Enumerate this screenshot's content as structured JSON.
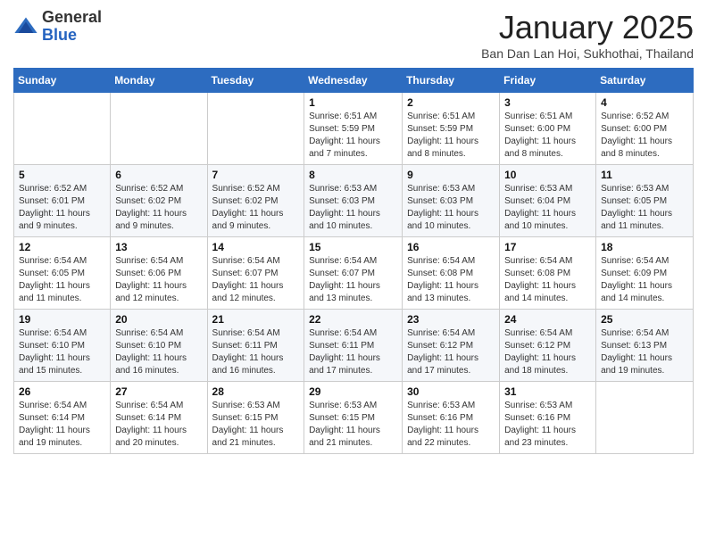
{
  "header": {
    "logo_general": "General",
    "logo_blue": "Blue",
    "month_title": "January 2025",
    "subtitle": "Ban Dan Lan Hoi, Sukhothai, Thailand"
  },
  "days_of_week": [
    "Sunday",
    "Monday",
    "Tuesday",
    "Wednesday",
    "Thursday",
    "Friday",
    "Saturday"
  ],
  "weeks": [
    [
      {
        "day": "",
        "sunrise": "",
        "sunset": "",
        "daylight": ""
      },
      {
        "day": "",
        "sunrise": "",
        "sunset": "",
        "daylight": ""
      },
      {
        "day": "",
        "sunrise": "",
        "sunset": "",
        "daylight": ""
      },
      {
        "day": "1",
        "sunrise": "Sunrise: 6:51 AM",
        "sunset": "Sunset: 5:59 PM",
        "daylight": "Daylight: 11 hours and 7 minutes."
      },
      {
        "day": "2",
        "sunrise": "Sunrise: 6:51 AM",
        "sunset": "Sunset: 5:59 PM",
        "daylight": "Daylight: 11 hours and 8 minutes."
      },
      {
        "day": "3",
        "sunrise": "Sunrise: 6:51 AM",
        "sunset": "Sunset: 6:00 PM",
        "daylight": "Daylight: 11 hours and 8 minutes."
      },
      {
        "day": "4",
        "sunrise": "Sunrise: 6:52 AM",
        "sunset": "Sunset: 6:00 PM",
        "daylight": "Daylight: 11 hours and 8 minutes."
      }
    ],
    [
      {
        "day": "5",
        "sunrise": "Sunrise: 6:52 AM",
        "sunset": "Sunset: 6:01 PM",
        "daylight": "Daylight: 11 hours and 9 minutes."
      },
      {
        "day": "6",
        "sunrise": "Sunrise: 6:52 AM",
        "sunset": "Sunset: 6:02 PM",
        "daylight": "Daylight: 11 hours and 9 minutes."
      },
      {
        "day": "7",
        "sunrise": "Sunrise: 6:52 AM",
        "sunset": "Sunset: 6:02 PM",
        "daylight": "Daylight: 11 hours and 9 minutes."
      },
      {
        "day": "8",
        "sunrise": "Sunrise: 6:53 AM",
        "sunset": "Sunset: 6:03 PM",
        "daylight": "Daylight: 11 hours and 10 minutes."
      },
      {
        "day": "9",
        "sunrise": "Sunrise: 6:53 AM",
        "sunset": "Sunset: 6:03 PM",
        "daylight": "Daylight: 11 hours and 10 minutes."
      },
      {
        "day": "10",
        "sunrise": "Sunrise: 6:53 AM",
        "sunset": "Sunset: 6:04 PM",
        "daylight": "Daylight: 11 hours and 10 minutes."
      },
      {
        "day": "11",
        "sunrise": "Sunrise: 6:53 AM",
        "sunset": "Sunset: 6:05 PM",
        "daylight": "Daylight: 11 hours and 11 minutes."
      }
    ],
    [
      {
        "day": "12",
        "sunrise": "Sunrise: 6:54 AM",
        "sunset": "Sunset: 6:05 PM",
        "daylight": "Daylight: 11 hours and 11 minutes."
      },
      {
        "day": "13",
        "sunrise": "Sunrise: 6:54 AM",
        "sunset": "Sunset: 6:06 PM",
        "daylight": "Daylight: 11 hours and 12 minutes."
      },
      {
        "day": "14",
        "sunrise": "Sunrise: 6:54 AM",
        "sunset": "Sunset: 6:07 PM",
        "daylight": "Daylight: 11 hours and 12 minutes."
      },
      {
        "day": "15",
        "sunrise": "Sunrise: 6:54 AM",
        "sunset": "Sunset: 6:07 PM",
        "daylight": "Daylight: 11 hours and 13 minutes."
      },
      {
        "day": "16",
        "sunrise": "Sunrise: 6:54 AM",
        "sunset": "Sunset: 6:08 PM",
        "daylight": "Daylight: 11 hours and 13 minutes."
      },
      {
        "day": "17",
        "sunrise": "Sunrise: 6:54 AM",
        "sunset": "Sunset: 6:08 PM",
        "daylight": "Daylight: 11 hours and 14 minutes."
      },
      {
        "day": "18",
        "sunrise": "Sunrise: 6:54 AM",
        "sunset": "Sunset: 6:09 PM",
        "daylight": "Daylight: 11 hours and 14 minutes."
      }
    ],
    [
      {
        "day": "19",
        "sunrise": "Sunrise: 6:54 AM",
        "sunset": "Sunset: 6:10 PM",
        "daylight": "Daylight: 11 hours and 15 minutes."
      },
      {
        "day": "20",
        "sunrise": "Sunrise: 6:54 AM",
        "sunset": "Sunset: 6:10 PM",
        "daylight": "Daylight: 11 hours and 16 minutes."
      },
      {
        "day": "21",
        "sunrise": "Sunrise: 6:54 AM",
        "sunset": "Sunset: 6:11 PM",
        "daylight": "Daylight: 11 hours and 16 minutes."
      },
      {
        "day": "22",
        "sunrise": "Sunrise: 6:54 AM",
        "sunset": "Sunset: 6:11 PM",
        "daylight": "Daylight: 11 hours and 17 minutes."
      },
      {
        "day": "23",
        "sunrise": "Sunrise: 6:54 AM",
        "sunset": "Sunset: 6:12 PM",
        "daylight": "Daylight: 11 hours and 17 minutes."
      },
      {
        "day": "24",
        "sunrise": "Sunrise: 6:54 AM",
        "sunset": "Sunset: 6:12 PM",
        "daylight": "Daylight: 11 hours and 18 minutes."
      },
      {
        "day": "25",
        "sunrise": "Sunrise: 6:54 AM",
        "sunset": "Sunset: 6:13 PM",
        "daylight": "Daylight: 11 hours and 19 minutes."
      }
    ],
    [
      {
        "day": "26",
        "sunrise": "Sunrise: 6:54 AM",
        "sunset": "Sunset: 6:14 PM",
        "daylight": "Daylight: 11 hours and 19 minutes."
      },
      {
        "day": "27",
        "sunrise": "Sunrise: 6:54 AM",
        "sunset": "Sunset: 6:14 PM",
        "daylight": "Daylight: 11 hours and 20 minutes."
      },
      {
        "day": "28",
        "sunrise": "Sunrise: 6:53 AM",
        "sunset": "Sunset: 6:15 PM",
        "daylight": "Daylight: 11 hours and 21 minutes."
      },
      {
        "day": "29",
        "sunrise": "Sunrise: 6:53 AM",
        "sunset": "Sunset: 6:15 PM",
        "daylight": "Daylight: 11 hours and 21 minutes."
      },
      {
        "day": "30",
        "sunrise": "Sunrise: 6:53 AM",
        "sunset": "Sunset: 6:16 PM",
        "daylight": "Daylight: 11 hours and 22 minutes."
      },
      {
        "day": "31",
        "sunrise": "Sunrise: 6:53 AM",
        "sunset": "Sunset: 6:16 PM",
        "daylight": "Daylight: 11 hours and 23 minutes."
      },
      {
        "day": "",
        "sunrise": "",
        "sunset": "",
        "daylight": ""
      }
    ]
  ]
}
